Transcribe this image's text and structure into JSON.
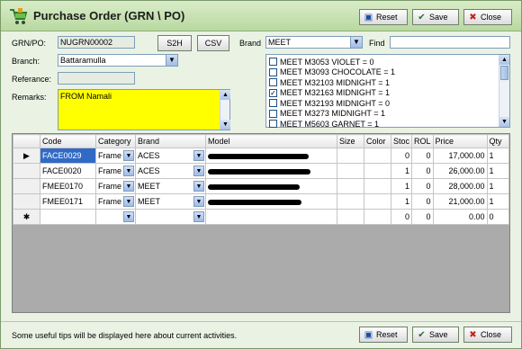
{
  "window": {
    "title": "Purchase Order (GRN \\ PO)"
  },
  "toolbar": {
    "reset": "Reset",
    "save": "Save",
    "close": "Close"
  },
  "form": {
    "grn_label": "GRN/PO:",
    "grn_value": "NUGRN00002",
    "s2h": "S2H",
    "csv": "CSV",
    "brand_label": "Brand",
    "brand_value": "MEET",
    "find_label": "Find",
    "find_value": "",
    "branch_label": "Branch:",
    "branch_value": "Battaramulla",
    "reference_label": "Referance:",
    "reference_value": "",
    "remarks_label": "Remarks:",
    "remarks_value": "FROM Namali"
  },
  "checklist": [
    {
      "label": "MEET M3053 VIOLET  = 0",
      "checked": false
    },
    {
      "label": "MEET M3093 CHOCOLATE  = 1",
      "checked": false
    },
    {
      "label": "MEET M32103 MIDNIGHT  = 1",
      "checked": false
    },
    {
      "label": "MEET M32163 MIDNIGHT  = 1",
      "checked": true
    },
    {
      "label": "MEET M32193 MIDNIGHT  = 0",
      "checked": false
    },
    {
      "label": "MEET M3273 MIDNIGHT  = 1",
      "checked": false
    },
    {
      "label": "MEET M5603 GARNET  = 1",
      "checked": false
    }
  ],
  "grid": {
    "columns": [
      "Code",
      "Category",
      "Brand",
      "Model",
      "Size",
      "Color",
      "Stoc",
      "ROL",
      "Price",
      "Qty"
    ],
    "rows": [
      {
        "marker": "▶",
        "code": "FACE0029",
        "category": "Frame",
        "brand": "ACES",
        "size": "",
        "color": "",
        "stock": "0",
        "rol": "0",
        "price": "17,000.00",
        "qty": "1"
      },
      {
        "marker": "",
        "code": "FACE0020",
        "category": "Frame",
        "brand": "ACES",
        "size": "",
        "color": "",
        "stock": "1",
        "rol": "0",
        "price": "26,000.00",
        "qty": "1"
      },
      {
        "marker": "",
        "code": "FMEE0170",
        "category": "Frame",
        "brand": "MEET",
        "size": "",
        "color": "",
        "stock": "1",
        "rol": "0",
        "price": "28,000.00",
        "qty": "1"
      },
      {
        "marker": "",
        "code": "FMEE0171",
        "category": "Frame",
        "brand": "MEET",
        "size": "",
        "color": "",
        "stock": "1",
        "rol": "0",
        "price": "21,000.00",
        "qty": "1"
      }
    ],
    "new_row": {
      "marker": "✱",
      "stock": "0",
      "rol": "0",
      "price": "0.00",
      "qty": "0"
    }
  },
  "status": {
    "text": "Some useful tips will be displayed here about current activities."
  },
  "colors": {
    "remarks_bg": "#ffff00",
    "selected_cell": "#316ac5",
    "window_bg": "#eaf2e4"
  }
}
